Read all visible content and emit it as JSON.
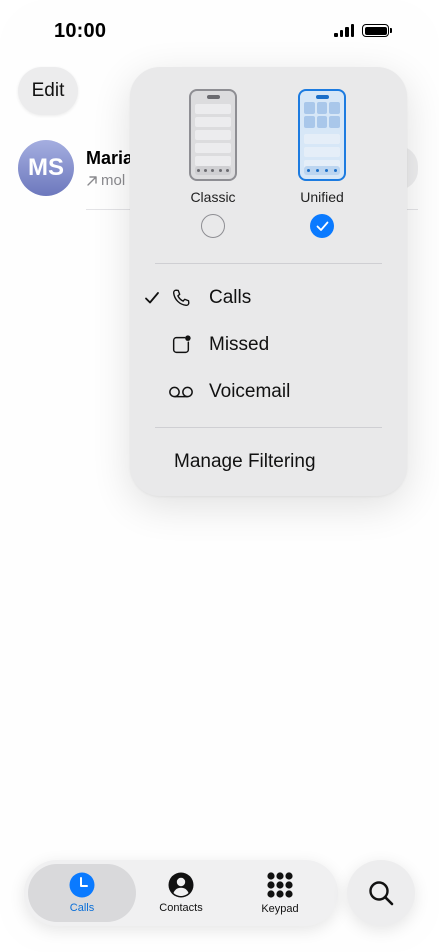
{
  "status_bar": {
    "time": "10:00",
    "signal_icon": "cellular-signal-icon",
    "battery_icon": "battery-icon"
  },
  "header": {
    "edit_label": "Edit"
  },
  "recent_call": {
    "initials": "MS",
    "name": "Maria",
    "subtitle": "mol",
    "direction_icon": "outgoing-arrow-icon"
  },
  "popover": {
    "layouts": [
      {
        "label": "Classic",
        "selected": false
      },
      {
        "label": "Unified",
        "selected": true
      }
    ],
    "filters": [
      {
        "label": "Calls",
        "icon": "phone-icon",
        "checked": true
      },
      {
        "label": "Missed",
        "icon": "missed-badge-icon",
        "checked": false
      },
      {
        "label": "Voicemail",
        "icon": "voicemail-icon",
        "checked": false
      }
    ],
    "manage_label": "Manage Filtering"
  },
  "tabbar": {
    "tabs": [
      {
        "label": "Calls",
        "icon": "clock-icon",
        "active": true
      },
      {
        "label": "Contacts",
        "icon": "person-icon",
        "active": false
      },
      {
        "label": "Keypad",
        "icon": "keypad-icon",
        "active": false
      }
    ],
    "search_icon": "search-icon"
  },
  "colors": {
    "accent": "#0a7aff",
    "active_tab_text": "#0a6fd8",
    "avatar_gradient_top": "#a5aee0",
    "avatar_gradient_bottom": "#6d78bd"
  }
}
